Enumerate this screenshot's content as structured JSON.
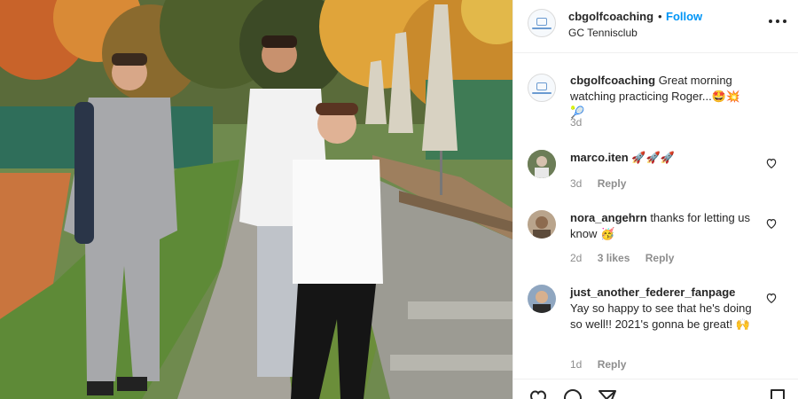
{
  "post": {
    "username": "cbgolfcoaching",
    "separator": "•",
    "follow_label": "Follow",
    "location": "GC Tennisclub",
    "more_icon": "more-options-icon"
  },
  "caption": {
    "username": "cbgolfcoaching",
    "text": "Great morning watching practicing Roger...",
    "emojis": "🤩💥🎾",
    "time": "3d"
  },
  "comments": [
    {
      "username": "marco.iten",
      "text": "",
      "emojis": "🚀🚀🚀",
      "time": "3d",
      "likes": "",
      "reply_label": "Reply"
    },
    {
      "username": "nora_angehrn",
      "text": "thanks for letting us know",
      "emojis": "🥳",
      "time": "2d",
      "likes": "3 likes",
      "reply_label": "Reply"
    },
    {
      "username": "just_another_federer_fanpage",
      "text": "Yay so happy to see that he's doing so well!! 2021's gonna be great!",
      "emojis": "🙌",
      "time": "1d",
      "likes": "",
      "reply_label": "Reply"
    }
  ],
  "action_icons": [
    "heart-icon",
    "comment-icon",
    "share-icon",
    "save-icon"
  ],
  "colors": {
    "accent": "#0095f6",
    "text": "#262626",
    "secondary": "#8e8e8e"
  }
}
